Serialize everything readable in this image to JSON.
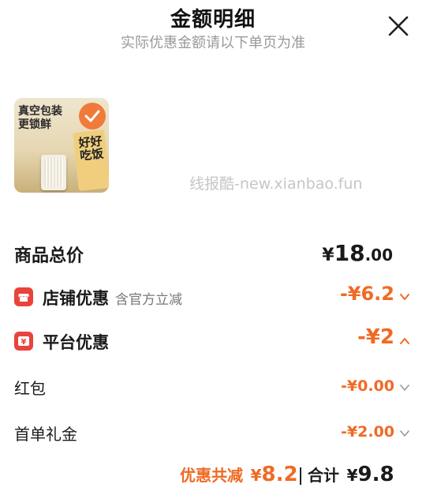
{
  "header": {
    "title": "金额明细",
    "subtitle": "实际优惠金额请以下单页为准"
  },
  "product": {
    "image_headline_1": "真空包装",
    "image_headline_2": "更锁鲜",
    "image_box_text": "好好吃饭"
  },
  "watermark": "线报酷-new.xianbao.fun",
  "total": {
    "label": "商品总价",
    "currency": "¥",
    "int": "18",
    "dec": ".00"
  },
  "shop_discount": {
    "label": "店铺优惠",
    "note": "含官方立减",
    "value": "-¥6.2"
  },
  "platform_discount": {
    "label": "平台优惠",
    "value": "-¥2"
  },
  "red_packet": {
    "label": "红包",
    "value": "-¥0.00"
  },
  "first_order": {
    "label": "首单礼金",
    "value": "-¥2.00"
  },
  "footer": {
    "discount_label": "优惠共减",
    "discount_currency": "¥",
    "discount_value": "8.2",
    "total_label": "合计",
    "total_currency": "¥",
    "total_value": "9.8"
  },
  "colors": {
    "accent": "#f06a24",
    "icon_red": "#e8433c"
  }
}
